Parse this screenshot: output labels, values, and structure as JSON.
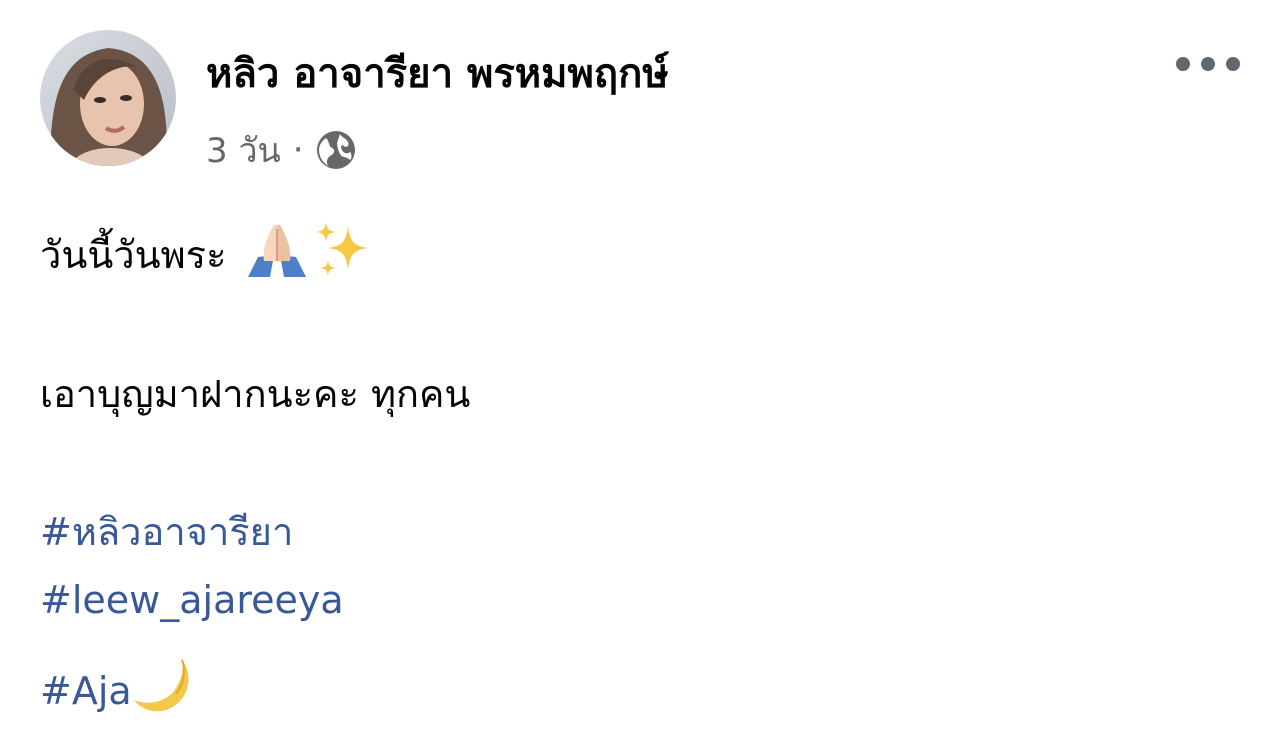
{
  "post": {
    "author": {
      "name": "หลิว อาจารียา พรหมพฤกษ์",
      "avatar": "profile-photo"
    },
    "meta": {
      "time": "3 วัน",
      "separator": "·",
      "privacy_icon": "globe-icon"
    },
    "more_icon": "more-options-icon",
    "lines": [
      {
        "text": "วันนี้วันพระ",
        "emojis": [
          "folded-hands-emoji",
          "sparkles-emoji"
        ]
      },
      {
        "text": "เอาบุญมาฝากนะคะ ทุกคน"
      }
    ],
    "hashtags": [
      {
        "text": "#หลิวอาจารียา"
      },
      {
        "text": "#leew_ajareeya"
      },
      {
        "text": "#Aja",
        "emoji": "crescent-moon-emoji"
      }
    ]
  },
  "colors": {
    "text": "#050505",
    "meta": "#65676b",
    "hashtag": "#385898",
    "background": "#ffffff"
  }
}
